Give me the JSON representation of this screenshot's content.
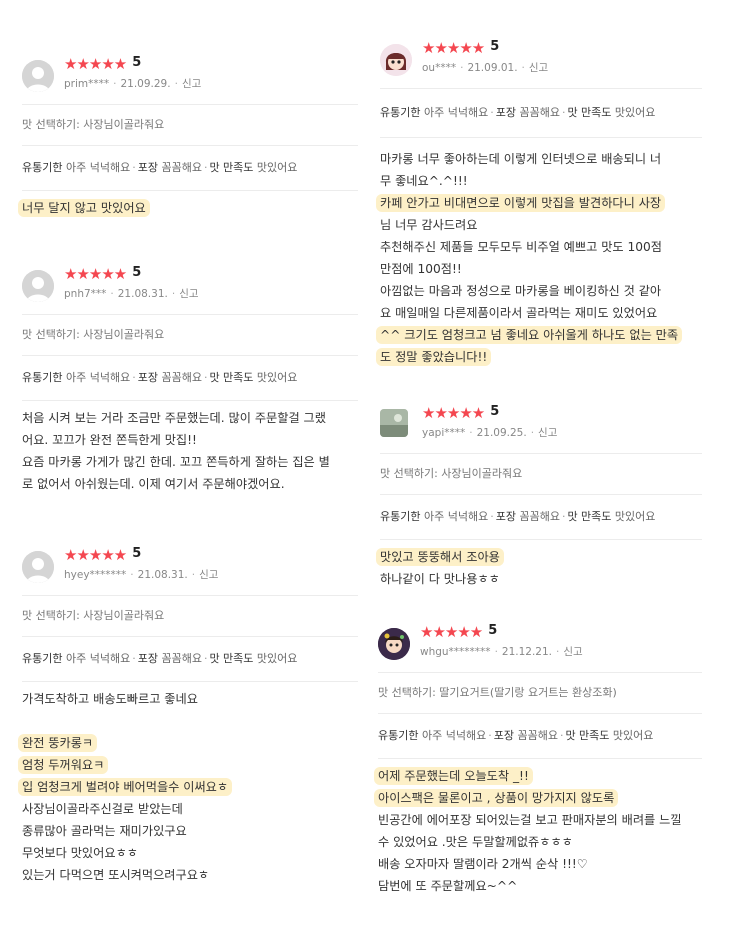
{
  "reviews": [
    {
      "score": "5",
      "user": "prim****",
      "date": "21.09.29.",
      "report": "신고",
      "taste_select": "맛 선택하기: 사장님이골라줘요",
      "tags": [
        {
          "k": "유통기한",
          "v": "아주 넉넉해요"
        },
        {
          "k": "포장",
          "v": "꼼꼼해요"
        },
        {
          "k": "맛 만족도",
          "v": "맛있어요"
        }
      ],
      "body": [
        "너무 달지 않고 맛있어요"
      ]
    },
    {
      "score": "5",
      "user": "pnh7***",
      "date": "21.08.31.",
      "report": "신고",
      "taste_select": "맛 선택하기: 사장님이골라줘요",
      "tags": [
        {
          "k": "유통기한",
          "v": "아주 넉넉해요"
        },
        {
          "k": "포장",
          "v": "꼼꼼해요"
        },
        {
          "k": "맛 만족도",
          "v": "맛있어요"
        }
      ],
      "body": [
        "처음 시켜 보는 거라 조금만 주문했는데. 많이 주문할걸 그랬",
        "어요. 꼬끄가 완전 쫀득한게 맛집!!",
        "요즘 마카롱 가게가 많긴 한데. 꼬끄 쫀득하게 잘하는 집은 별",
        "로 없어서 아쉬웠는데. 이제 여기서 주문해야겠어요."
      ]
    },
    {
      "score": "5",
      "user": "hyey*******",
      "date": "21.08.31.",
      "report": "신고",
      "taste_select": "맛 선택하기: 사장님이골라줘요",
      "tags": [
        {
          "k": "유통기한",
          "v": "아주 넉넉해요"
        },
        {
          "k": "포장",
          "v": "꼼꼼해요"
        },
        {
          "k": "맛 만족도",
          "v": "맛있어요"
        }
      ],
      "body": [
        "가격도착하고 배송도빠르고 좋네요",
        "",
        "완전 뚱카롱ㅋ",
        "엄청 두꺼워요ㅋ",
        "입 엄청크게 벌려야 베어먹을수 이써요ㅎ",
        "사장님이골라주신걸로 받았는데",
        "종류많아 골라먹는 재미가있구요",
        "무엇보다 맛있어요ㅎㅎ",
        "있는거 다먹으면 또시켜먹으려구요ㅎ"
      ]
    },
    {
      "score": "5",
      "user": "ou****",
      "date": "21.09.01.",
      "report": "신고",
      "tags": [
        {
          "k": "유통기한",
          "v": "아주 넉넉해요"
        },
        {
          "k": "포장",
          "v": "꼼꼼해요"
        },
        {
          "k": "맛 만족도",
          "v": "맛있어요"
        }
      ],
      "body": [
        "마카롱 너무 좋아하는데 이렇게 인터넷으로 배송되니 너",
        "무 좋네요^.^!!!",
        "카페 안가고 비대면으로 이렇게 맛집을 발견하다니 사장",
        "님 너무 감사드려요",
        "추천해주신 제품들 모두모두 비주얼 예쁘고 맛도 100점",
        "만점에 100점!!",
        "아낌없는 마음과 정성으로 마카롱을 베이킹하신 것 같아",
        "요 매일매일 다른제품이라서 골라먹는 재미도 있었어요",
        "^^ 크기도 엄청크고 넘 좋네요 아쉬울게 하나도 없는 만족",
        "도 정말 좋았습니다!!"
      ]
    },
    {
      "score": "5",
      "user": "yapi****",
      "date": "21.09.25.",
      "report": "신고",
      "taste_select": "맛 선택하기: 사장님이골라줘요",
      "tags": [
        {
          "k": "유통기한",
          "v": "아주 넉넉해요"
        },
        {
          "k": "포장",
          "v": "꼼꼼해요"
        },
        {
          "k": "맛 만족도",
          "v": "맛있어요"
        }
      ],
      "body": [
        "맛있고 뚱뚱해서 조아용",
        "하나같이 다 맛나용ㅎㅎ"
      ]
    },
    {
      "score": "5",
      "user": "whgu********",
      "date": "21.12.21.",
      "report": "신고",
      "taste_select": "맛 선택하기: 딸기요거트(딸기랑 요거트는 환상조화)",
      "tags": [
        {
          "k": "유통기한",
          "v": "아주 넉넉해요"
        },
        {
          "k": "포장",
          "v": "꼼꼼해요"
        },
        {
          "k": "맛 만족도",
          "v": "맛있어요"
        }
      ],
      "body": [
        "어제 주문했는데 오늘도착 _!!",
        "아이스팩은 물론이고 , 상품이 망가지지 않도록",
        "빈공간에 에어포장 되어있는걸 보고 판매자분의 배려를 느낄",
        "수 있었어요 .맛은 두말할께없쥬ㅎㅎㅎ",
        "배송 오자마자 딸램이라 2개씩 순삭 !!!♡",
        "담번에 또 주문할께요~^^"
      ]
    }
  ],
  "colors": {
    "star": "#f44750",
    "highlight": "#fdf0c8",
    "divider": "#ececec"
  }
}
